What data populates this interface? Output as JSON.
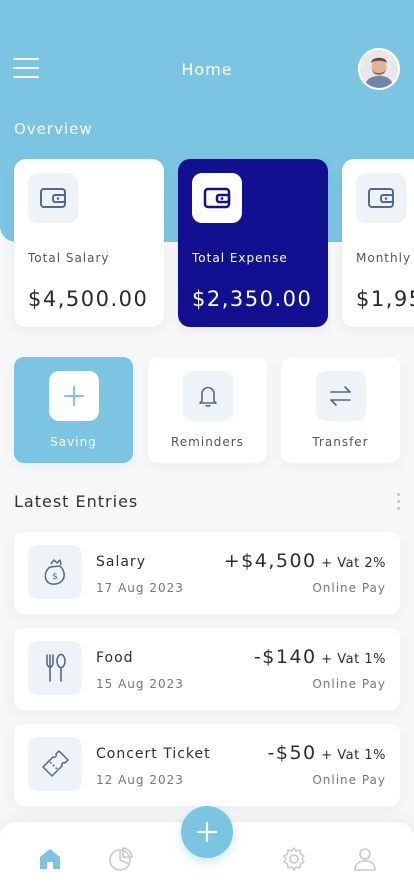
{
  "header": {
    "title": "Home",
    "section_title": "Overview"
  },
  "overview_cards": [
    {
      "label": "Total Salary",
      "amount": "$4,500.00"
    },
    {
      "label": "Total Expense",
      "amount": "$2,350.00"
    },
    {
      "label": "Monthly",
      "amount": "$1,95"
    }
  ],
  "actions": [
    {
      "label": "Saving"
    },
    {
      "label": "Reminders"
    },
    {
      "label": "Transfer"
    }
  ],
  "latest": {
    "title": "Latest Entries",
    "entries": [
      {
        "name": "Salary",
        "date": "17 Aug 2023",
        "amount": "+$4,500",
        "vat": " + Vat 2%",
        "method": "Online Pay",
        "icon": "money-bag-icon"
      },
      {
        "name": "Food",
        "date": "15 Aug 2023",
        "amount": "-$140",
        "vat": " + Vat 1%",
        "method": "Online Pay",
        "icon": "utensils-icon"
      },
      {
        "name": "Concert Ticket",
        "date": "12 Aug 2023",
        "amount": "-$50",
        "vat": " + Vat 1%",
        "method": "Online Pay",
        "icon": "ticket-icon"
      }
    ]
  },
  "colors": {
    "accent": "#7cc5e2",
    "dark_card": "#121090",
    "icon_blue": "#3a5a8c"
  }
}
